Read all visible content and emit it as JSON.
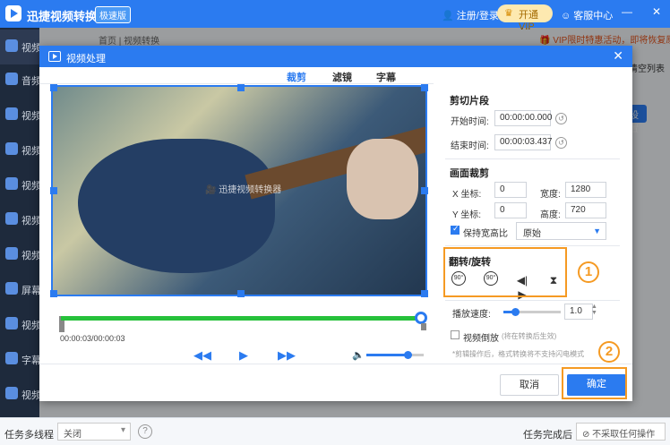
{
  "app": {
    "name": "迅捷视频转换器",
    "edition": "极速版",
    "login": "注册/登录",
    "vip": "开通VIP",
    "service": "客服中心"
  },
  "sidebar": {
    "items": [
      {
        "label": "视频转换"
      },
      {
        "label": "音频"
      },
      {
        "label": "视频"
      },
      {
        "label": "视频"
      },
      {
        "label": "视频"
      },
      {
        "label": "视频"
      },
      {
        "label": "视频"
      },
      {
        "label": "屏幕"
      },
      {
        "label": "视频"
      },
      {
        "label": "字幕"
      },
      {
        "label": "视频"
      }
    ]
  },
  "breadcrumb": {
    "path": "首页 | 视频转换",
    "promo": "VIP限时特惠活动，即将恢复原价"
  },
  "background": {
    "clear_list": "清空列表",
    "partial_label": "设置",
    "right_partial": "全"
  },
  "bottombar": {
    "multithread_label": "任务多线程",
    "multithread_value": "关闭",
    "help": "?",
    "done_label": "任务完成后",
    "done_value": "不采取任何操作"
  },
  "dialog": {
    "title": "视频处理",
    "tabs": [
      {
        "label": "裁剪",
        "active": true
      },
      {
        "label": "滤镜",
        "active": false
      },
      {
        "label": "字幕",
        "active": false
      }
    ],
    "watermark": "迅捷视频转换器",
    "timecode": "00:00:03/00:00:03",
    "progress": 1.0,
    "volume": 0.72,
    "clip": {
      "title": "剪切片段",
      "start_label": "开始时间:",
      "start_value": "00:00:00.000",
      "end_label": "结束时间:",
      "end_value": "00:00:03.437"
    },
    "crop": {
      "title": "画面裁剪",
      "x_label": "X 坐标:",
      "x_value": "0",
      "width_label": "宽度:",
      "width_value": "1280",
      "y_label": "Y 坐标:",
      "y_value": "0",
      "height_label": "高度:",
      "height_value": "720",
      "keep_ratio_label": "保持宽高比",
      "keep_ratio_checked": true,
      "ratio_value": "原始"
    },
    "rotate": {
      "title": "翻转/旋转",
      "buttons": [
        "90°",
        "90°"
      ]
    },
    "speed": {
      "label": "播放速度:",
      "value": "1.0",
      "level": 0.2
    },
    "reverse": {
      "label": "视频倒放",
      "note": "(将在转换后生效)"
    },
    "tip": "*剪辑操作后，格式转换将不支持闪电模式",
    "cancel": "取消",
    "ok": "确定"
  },
  "callouts": {
    "one": "1",
    "two": "2"
  },
  "colors": {
    "accent": "#2b7bf0",
    "highlight": "#f59a23",
    "progress": "#26c13a",
    "sidebar": "#1e2a3c"
  }
}
